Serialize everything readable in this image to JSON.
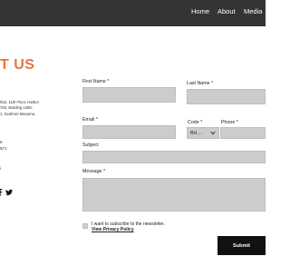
{
  "colors": {
    "accent": "#e8743b",
    "header": "#343434",
    "field": "#cccccc",
    "button": "#111111"
  },
  "nav": {
    "items": [
      "Home",
      "About",
      "Media"
    ]
  },
  "contact": {
    "title": "T US",
    "address_lines": [
      "rbor, 11th Floor, Harbor",
      "700, Building 1398,",
      "1, Seafront Manama,"
    ],
    "phone_lines": [
      "6",
      "671"
    ],
    "email_fragment": "i",
    "social_icons": [
      "facebook-icon",
      "twitter-icon"
    ]
  },
  "form": {
    "first_name_label": "First Name *",
    "last_name_label": "Last Name *",
    "email_label": "Email *",
    "code_label": "Code *",
    "phone_label": "Phone *",
    "code_value": "BH ...",
    "subject_label": "Subject",
    "message_label": "Message *",
    "newsletter_label": "I want to subscribe to the newsletter.",
    "privacy_link": "View Privacy Policy",
    "submit_label": "Submit"
  }
}
